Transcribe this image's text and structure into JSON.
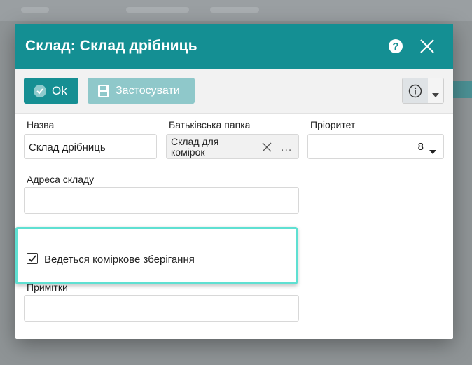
{
  "dialog": {
    "title": "Склад: Склад дрібниць",
    "help_glyph": "?"
  },
  "toolbar": {
    "ok_label": "Ok",
    "apply_label": "Застосувати"
  },
  "form": {
    "name_label": "Назва",
    "name_value": "Склад дрібниць",
    "parent_label": "Батьківська папка",
    "parent_value": "Склад для комірок",
    "more_glyph": "...",
    "priority_label": "Пріоритет",
    "priority_value": "8",
    "address_label": "Адреса складу",
    "address_value": "",
    "cell_storage_label": "Ведеться коміркове зберігання",
    "cell_storage_checked": true,
    "notes_label": "Примітки",
    "notes_value": ""
  },
  "colors": {
    "accent": "#148f93",
    "highlight": "#5fe0d2"
  },
  "icons": [
    "help-icon",
    "close-icon",
    "check-circle-icon",
    "save-icon",
    "info-icon",
    "chevron-down-icon",
    "clear-icon",
    "checkmark-icon"
  ]
}
